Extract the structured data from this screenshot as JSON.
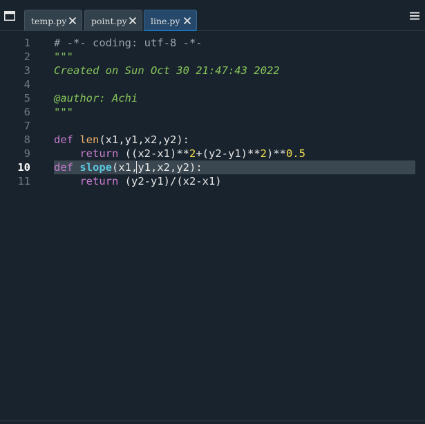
{
  "tabs": [
    {
      "label": "temp.py",
      "active": false
    },
    {
      "label": "point.py",
      "active": false
    },
    {
      "label": "line.py",
      "active": true
    }
  ],
  "icons": {
    "pane": "window-pane-icon",
    "close": "close-icon",
    "menu": "hamburger-menu-icon"
  },
  "editor": {
    "current_line": 10,
    "line_numbers": [
      "1",
      "2",
      "3",
      "4",
      "5",
      "6",
      "7",
      "8",
      "9",
      "10",
      "11"
    ],
    "lines": [
      [
        {
          "t": "# -*- coding: utf-8 -*-",
          "k": "comment"
        }
      ],
      [
        {
          "t": "\"\"\"",
          "k": "string"
        }
      ],
      [
        {
          "t": "Created on Sun Oct 30 21:47:43 2022",
          "k": "string"
        }
      ],
      [],
      [
        {
          "t": "@author: Achi",
          "k": "string"
        }
      ],
      [
        {
          "t": "\"\"\"",
          "k": "string"
        }
      ],
      [],
      [
        {
          "t": "def",
          "k": "keyword"
        },
        {
          "t": " ",
          "k": "plain"
        },
        {
          "t": "len",
          "k": "builtin"
        },
        {
          "t": "(x1,y1,x2,y2):",
          "k": "plain"
        }
      ],
      [
        {
          "t": "    ",
          "k": "plain"
        },
        {
          "t": "return",
          "k": "keyword"
        },
        {
          "t": " ((x2-x1)**",
          "k": "plain"
        },
        {
          "t": "2",
          "k": "num"
        },
        {
          "t": "+(y2-y1)**",
          "k": "plain"
        },
        {
          "t": "2",
          "k": "num"
        },
        {
          "t": ")**",
          "k": "plain"
        },
        {
          "t": "0.5",
          "k": "num"
        }
      ],
      [
        {
          "t": "def",
          "k": "keyword"
        },
        {
          "t": " ",
          "k": "plain"
        },
        {
          "t": "slope",
          "k": "fn"
        },
        {
          "t": "(x1,y1,x2,y2):",
          "k": "plain"
        }
      ],
      [
        {
          "t": "    ",
          "k": "plain"
        },
        {
          "t": "return",
          "k": "keyword"
        },
        {
          "t": " (y2-y1)/(x2-x1)",
          "k": "plain"
        }
      ]
    ]
  },
  "colors": {
    "background": "#19232d",
    "active_tab": "#26486b",
    "active_tab_underline": "#1a72bb",
    "current_line": "#3a4650"
  }
}
